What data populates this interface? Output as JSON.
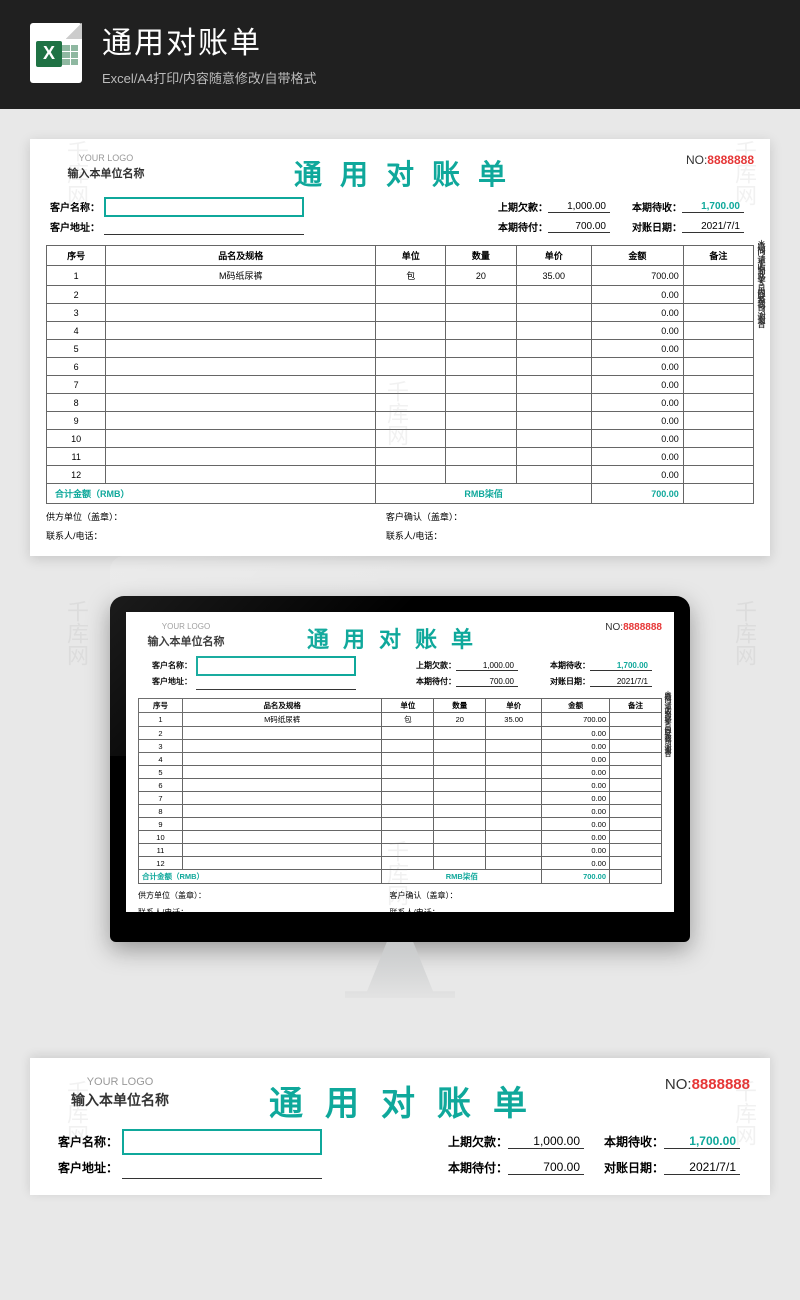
{
  "header": {
    "title": "通用对账单",
    "subtitle": "Excel/A4打印/内容随意修改/自带格式",
    "icon_letter": "X"
  },
  "watermark_text": "千库网",
  "sheet": {
    "logo_text": "YOUR LOGO",
    "unit_name": "输入本单位名称",
    "title": "通用对账单",
    "no_label": "NO:",
    "no_value": "8888888",
    "info": {
      "customer_name_label": "客户名称：",
      "customer_address_label": "客户地址：",
      "prev_debt_label": "上期欠款：",
      "prev_debt_value": "1,000.00",
      "curr_receivable_label": "本期待收：",
      "curr_receivable_value": "1,700.00",
      "curr_payable_label": "本期待付：",
      "curr_payable_value": "700.00",
      "rec_date_label": "对账日期：",
      "rec_date_value": "2021/7/1"
    },
    "columns": {
      "seq": "序号",
      "name": "品名及规格",
      "unit": "单位",
      "qty": "数量",
      "price": "单价",
      "amount": "金额",
      "note": "备注"
    },
    "rows": [
      {
        "seq": "1",
        "name": "M码纸尿裤",
        "unit": "包",
        "qty": "20",
        "price": "35.00",
        "amount": "700.00",
        "note": ""
      },
      {
        "seq": "2",
        "name": "",
        "unit": "",
        "qty": "",
        "price": "",
        "amount": "0.00",
        "note": ""
      },
      {
        "seq": "3",
        "name": "",
        "unit": "",
        "qty": "",
        "price": "",
        "amount": "0.00",
        "note": ""
      },
      {
        "seq": "4",
        "name": "",
        "unit": "",
        "qty": "",
        "price": "",
        "amount": "0.00",
        "note": ""
      },
      {
        "seq": "5",
        "name": "",
        "unit": "",
        "qty": "",
        "price": "",
        "amount": "0.00",
        "note": ""
      },
      {
        "seq": "6",
        "name": "",
        "unit": "",
        "qty": "",
        "price": "",
        "amount": "0.00",
        "note": ""
      },
      {
        "seq": "7",
        "name": "",
        "unit": "",
        "qty": "",
        "price": "",
        "amount": "0.00",
        "note": ""
      },
      {
        "seq": "8",
        "name": "",
        "unit": "",
        "qty": "",
        "price": "",
        "amount": "0.00",
        "note": ""
      },
      {
        "seq": "9",
        "name": "",
        "unit": "",
        "qty": "",
        "price": "",
        "amount": "0.00",
        "note": ""
      },
      {
        "seq": "10",
        "name": "",
        "unit": "",
        "qty": "",
        "price": "",
        "amount": "0.00",
        "note": ""
      },
      {
        "seq": "11",
        "name": "",
        "unit": "",
        "qty": "",
        "price": "",
        "amount": "0.00",
        "note": ""
      },
      {
        "seq": "12",
        "name": "",
        "unit": "",
        "qty": "",
        "price": "",
        "amount": "0.00",
        "note": ""
      }
    ],
    "total": {
      "label": "合计金额（RMB）",
      "rmb_text": "RMB柒佰",
      "amount": "700.00"
    },
    "signatures": {
      "supplier_seal": "供方单位（盖章）：",
      "customer_seal": "客户确认（盖章）：",
      "contact": "联系人/电话："
    },
    "side_notice": "＊疑问，请于收到此单5日内联系我司，谢谢合"
  }
}
